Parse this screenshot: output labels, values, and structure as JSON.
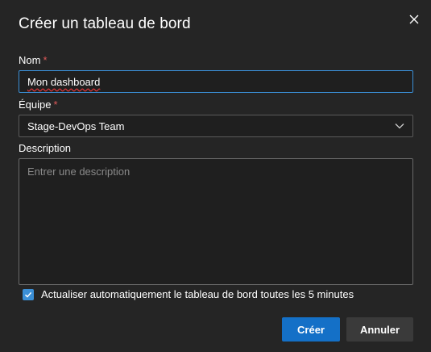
{
  "dialog": {
    "title": "Créer un tableau de bord",
    "close_icon": "close-icon"
  },
  "form": {
    "name": {
      "label": "Nom",
      "required_marker": "*",
      "value": "Mon dashboard"
    },
    "team": {
      "label": "Équipe",
      "required_marker": "*",
      "selected": "Stage-DevOps Team",
      "icon": "chevron-down-icon"
    },
    "description": {
      "label": "Description",
      "placeholder": "Entrer une description",
      "value": ""
    },
    "auto_refresh": {
      "checked": true,
      "label": "Actualiser automatiquement le tableau de bord toutes les 5 minutes"
    }
  },
  "buttons": {
    "create_label": "Créer",
    "cancel_label": "Annuler"
  },
  "colors": {
    "accent": "#1470c7",
    "focus_border": "#3b8fd6",
    "required": "#e05a5a",
    "background": "#252525"
  }
}
